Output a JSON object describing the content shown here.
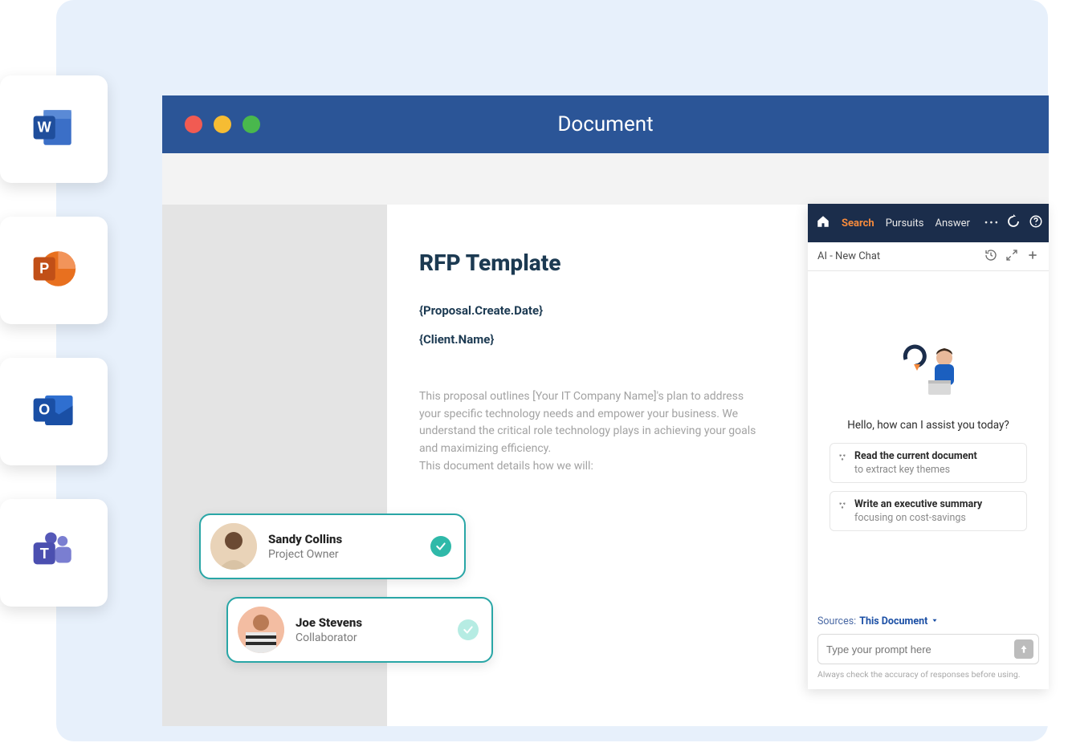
{
  "apps": {
    "word": "word-icon",
    "powerpoint": "powerpoint-icon",
    "outlook": "outlook-icon",
    "teams": "teams-icon"
  },
  "window": {
    "title": "Document"
  },
  "page": {
    "title": "RFP Template",
    "field_date": "{Proposal.Create.Date}",
    "field_client": "{Client.Name}",
    "body_p1": "This proposal outlines [Your IT Company Name]'s plan to address your specific technology needs and empower your business. We understand the critical role technology plays in achieving your goals and maximizing efficiency.",
    "body_p2": "This document details how we will:"
  },
  "collaborators": [
    {
      "name": "Sandy Collins",
      "role": "Project Owner",
      "checked": true
    },
    {
      "name": "Joe Stevens",
      "role": "Collaborator",
      "checked": true
    }
  ],
  "ai": {
    "tabs": {
      "search": "Search",
      "pursuits": "Pursuits",
      "answer": "Answer"
    },
    "ellipsis": "•••",
    "subheader": "AI - New Chat",
    "greeting": "Hello, how can I assist you today?",
    "suggestions": [
      {
        "title": "Read the current document",
        "sub": "to extract key themes"
      },
      {
        "title": "Write an executive summary",
        "sub": "focusing on cost-savings"
      }
    ],
    "sources_label": "Sources:",
    "sources_value": "This Document",
    "prompt_placeholder": "Type your prompt here",
    "disclaimer": "Always check the accuracy of responses before using."
  }
}
